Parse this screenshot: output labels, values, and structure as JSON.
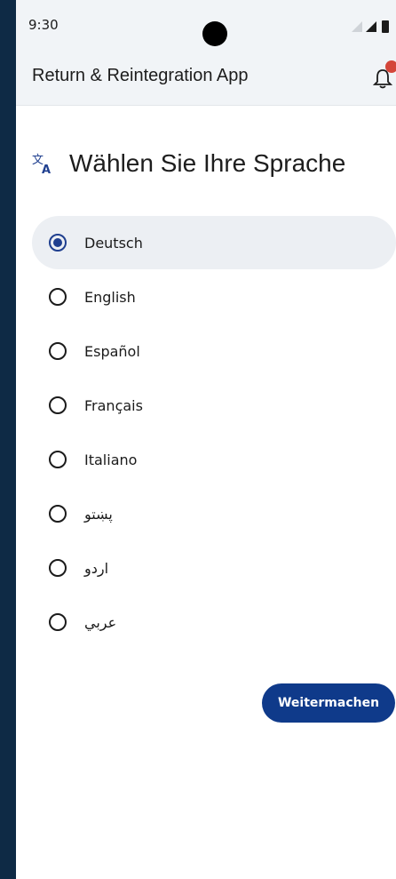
{
  "status": {
    "time": "9:30"
  },
  "app": {
    "title": "Return & Reintegration App"
  },
  "page": {
    "heading": "Wählen Sie Ihre Sprache"
  },
  "languages": [
    {
      "label": "Deutsch",
      "selected": true
    },
    {
      "label": "English",
      "selected": false
    },
    {
      "label": "Español",
      "selected": false
    },
    {
      "label": "Français",
      "selected": false
    },
    {
      "label": "Italiano",
      "selected": false
    },
    {
      "label": "پښتو",
      "selected": false
    },
    {
      "label": "اردو",
      "selected": false
    },
    {
      "label": "عربي",
      "selected": false
    }
  ],
  "actions": {
    "continue_label": "Weitermachen"
  },
  "colors": {
    "primary": "#0f3a8a",
    "badge": "#d4463a",
    "selected_bg": "#eceff3"
  }
}
